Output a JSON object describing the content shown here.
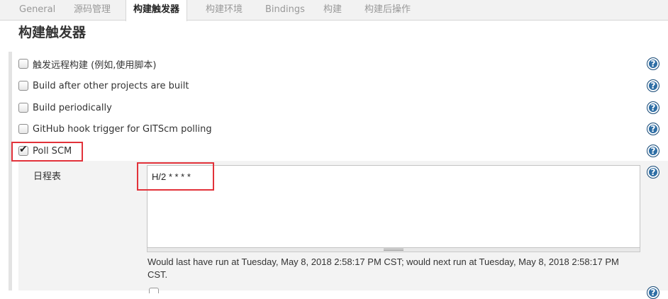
{
  "tabs": [
    {
      "label": "General",
      "active": false
    },
    {
      "label": "源码管理",
      "active": false
    },
    {
      "label": "构建触发器",
      "active": true
    },
    {
      "label": "构建环境",
      "active": false
    },
    {
      "label": "Bindings",
      "active": false
    },
    {
      "label": "构建",
      "active": false
    },
    {
      "label": "构建后操作",
      "active": false
    }
  ],
  "section": {
    "title": "构建触发器"
  },
  "triggers": [
    {
      "label": "触发远程构建 (例如,使用脚本)",
      "checked": false
    },
    {
      "label": "Build after other projects are built",
      "checked": false
    },
    {
      "label": "Build periodically",
      "checked": false
    },
    {
      "label": "GitHub hook trigger for GITScm polling",
      "checked": false
    },
    {
      "label": "Poll SCM",
      "checked": true
    }
  ],
  "poll_scm": {
    "schedule_label": "日程表",
    "schedule_value": "H/2 * * * *",
    "schedule_note": "Would last have run at Tuesday, May 8, 2018 2:58:17 PM CST; would next run at Tuesday, May 8, 2018 2:58:17 PM CST."
  },
  "help_icon": "?",
  "icons": {
    "checkbox_tick": "✔",
    "help": "question-circle-icon"
  },
  "colors": {
    "highlight": "#e2323a",
    "help_icon": "#2e6ea5",
    "tab_bar": "#f2f2f2"
  }
}
